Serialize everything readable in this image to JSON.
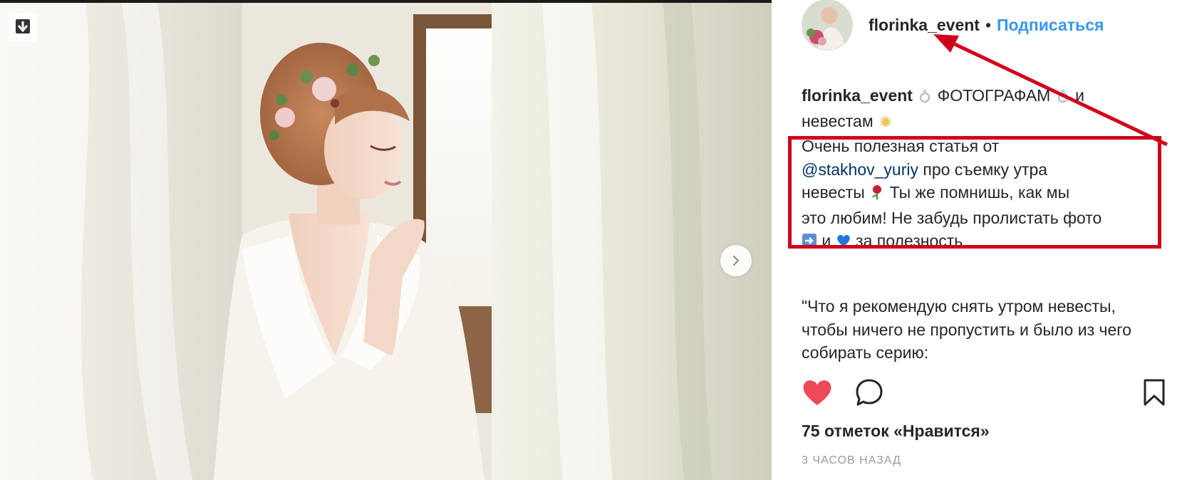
{
  "photo": {
    "alt": "",
    "download_icon": "download-arrow-icon",
    "next_icon": "chevron-right-icon"
  },
  "header": {
    "username": "florinka_event",
    "separator": "•",
    "follow_label": "Подписаться"
  },
  "caption": {
    "username": "florinka_event",
    "line1_text": "ФОТОГРАФАМ",
    "line1_and": "и",
    "line2_text": "невестам",
    "p1": "Очень полезная статья от",
    "mention": "@stakhov_yuriy",
    "p2": "про съемку утра",
    "p3": "невесты",
    "p4": "Ты же помнишь, как мы",
    "p5": "это любим! Не забудь пролистать фото",
    "p6_and": "и",
    "p6_end": "за полезность"
  },
  "quote": {
    "text": "\"Что я рекомендую снять утром невесты, чтобы ничего не пропустить и было из чего собирать серию:"
  },
  "actions": {
    "like_icon": "heart-filled-icon",
    "comment_icon": "comment-icon",
    "save_icon": "bookmark-icon",
    "like_color": "#ed4956"
  },
  "likes": {
    "text": "75 отметок «Нравится»"
  },
  "time": {
    "text": "3 ЧАСОВ НАЗАД"
  },
  "annotation": {
    "color": "#d0021b"
  }
}
